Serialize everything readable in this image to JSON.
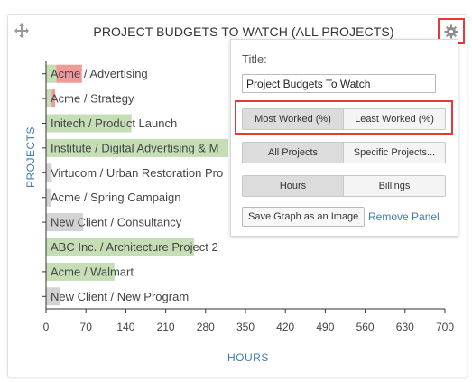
{
  "widget": {
    "title": "PROJECT BUDGETS TO WATCH (ALL PROJECTS)",
    "icons": {
      "move": "move-icon",
      "settings": "gear-icon"
    }
  },
  "panel": {
    "title_label": "Title:",
    "title_value": "Project Budgets To Watch",
    "sort_options": [
      "Most Worked (%)",
      "Least Worked (%)"
    ],
    "sort_selected": "Most Worked (%)",
    "scope_options": [
      "All Projects",
      "Specific Projects..."
    ],
    "scope_selected": "All Projects",
    "unit_options": [
      "Hours",
      "Billings"
    ],
    "unit_selected": "Hours",
    "save_label": "Save Graph as an Image",
    "remove_label": "Remove Panel"
  },
  "chart_data": {
    "type": "bar",
    "orientation": "horizontal",
    "ylabel": "PROJECTS",
    "xlabel": "HOURS",
    "xlim": [
      0,
      700
    ],
    "xticks": [
      "0",
      "70",
      "140",
      "210",
      "280",
      "350",
      "420",
      "490",
      "560",
      "630",
      "700"
    ],
    "categories": [
      "Acme / Advertising",
      "Acme / Strategy",
      "Initech / Product Launch",
      "Institute / Digital Advertising & M",
      "Virtucom / Urban Restoration Pro",
      "Acme / Spring Campaign",
      "New Client / Consultancy",
      "ABC Inc. / Architecture Project 2",
      "Acme / Walmart",
      "New Client / New Program"
    ],
    "bars": [
      {
        "budget": 18,
        "overage": 45
      },
      {
        "budget": 10,
        "overage": 6
      },
      {
        "budget": 150,
        "overage": 0
      },
      {
        "budget": 320,
        "overage": 0
      },
      {
        "budget": 10,
        "overage": 0
      },
      {
        "budget": 8,
        "overage": 0
      },
      {
        "budget": 65,
        "overage": 0
      },
      {
        "budget": 260,
        "overage": 0
      },
      {
        "budget": 120,
        "overage": 0
      },
      {
        "budget": 25,
        "overage": 0
      }
    ],
    "colors": {
      "green": "#c5deb5",
      "red": "#ef9a9a",
      "gray": "#d3d3d3"
    },
    "bar_color_keys": [
      "green",
      "green",
      "green",
      "green",
      "gray",
      "gray",
      "gray",
      "green",
      "green",
      "gray"
    ]
  }
}
